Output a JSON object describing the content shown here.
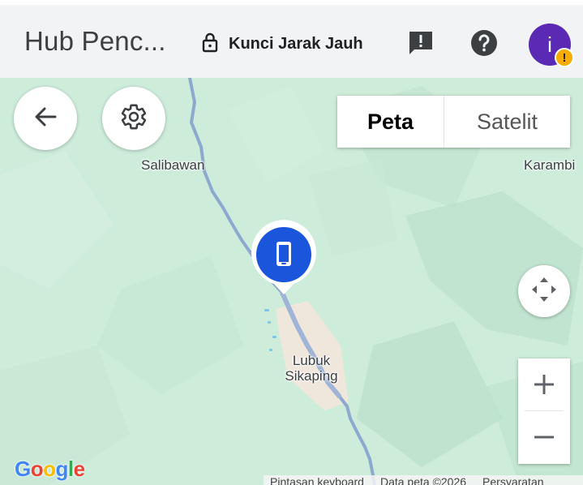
{
  "header": {
    "app_title": "Hub Penc...",
    "lock_label": "Kunci Jarak Jauh",
    "avatar_letter": "i",
    "avatar_badge": "!"
  },
  "map": {
    "map_type_options": [
      "Peta",
      "Satelit"
    ],
    "selected_map_type": "Peta",
    "places": {
      "salibawan": "Salibawan",
      "karambi": "Karambi",
      "lubuk_line1": "Lubuk",
      "lubuk_line2": "Sikaping"
    },
    "zoom_in_label": "+",
    "zoom_out_label": "−",
    "google_logo": [
      "G",
      "o",
      "o",
      "g",
      "l",
      "e"
    ],
    "google_colors": [
      "#4285F4",
      "#EA4335",
      "#FBBC05",
      "#4285F4",
      "#34A853",
      "#EA4335"
    ],
    "attribution": {
      "shortcuts": "Pintasan keyboard",
      "map_data": "Data peta ©2026",
      "terms": "Persyaratan"
    }
  },
  "colors": {
    "accent_blue": "#1a56db",
    "avatar_purple": "#5b2ab5",
    "warning_amber": "#f9ab00",
    "map_green": "#cfeedd",
    "river": "#8ea9cf"
  },
  "icons": {
    "lock": "lock-icon",
    "feedback": "feedback-icon",
    "help": "help-icon",
    "back": "arrow-back-icon",
    "settings": "gear-icon",
    "device": "phone-icon",
    "pan": "pan-arrows-icon"
  }
}
